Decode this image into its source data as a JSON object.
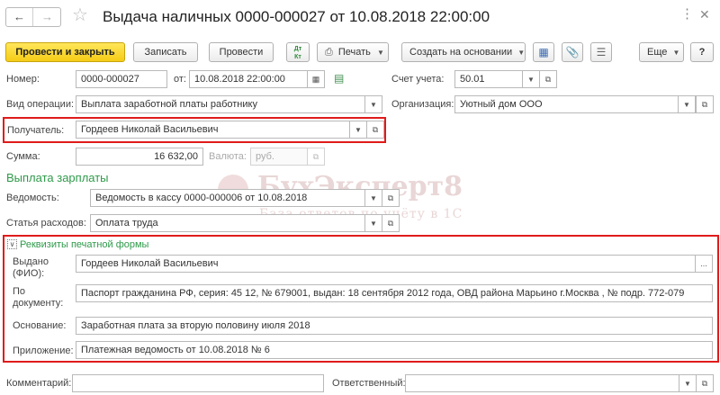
{
  "window": {
    "title": "Выдача наличных 0000-000027 от 10.08.2018 22:00:00"
  },
  "toolbar": {
    "post_close_label": "Провести и закрыть",
    "save_label": "Записать",
    "post_label": "Провести",
    "dt_kt_label": "Дт Кт",
    "print_label": "Печать",
    "create_based_label": "Создать на основании",
    "more_label": "Еще",
    "help_label": "?"
  },
  "header": {
    "number_label": "Номер:",
    "number_value": "0000-000027",
    "date_label": "от:",
    "date_value": "10.08.2018 22:00:00",
    "account_label": "Счет учета:",
    "account_value": "50.01",
    "operation_label": "Вид операции:",
    "operation_value": "Выплата заработной платы работнику",
    "organization_label": "Организация:",
    "organization_value": "Уютный дом ООО",
    "recipient_label": "Получатель:",
    "recipient_value": "Гордеев Николай Васильевич",
    "sum_label": "Сумма:",
    "sum_value": "16 632,00",
    "currency_label": "Валюта:",
    "currency_value": "руб."
  },
  "salary": {
    "title": "Выплата зарплаты",
    "statement_label": "Ведомость:",
    "statement_value": "Ведомость в кассу 0000-000006 от 10.08.2018",
    "expense_label": "Статья расходов:",
    "expense_value": "Оплата труда"
  },
  "print_form": {
    "title": "Реквизиты печатной формы",
    "issued_label_1": "Выдано",
    "issued_label_2": "(ФИО):",
    "issued_value": "Гордеев Николай Васильевич",
    "document_label_1": "По",
    "document_label_2": "документу:",
    "document_value": "Паспорт гражданина РФ, серия: 45 12, № 679001, выдан: 18 сентября 2012 года, ОВД района Марьино г.Москва , № подр. 772-079",
    "basis_label": "Основание:",
    "basis_value": "Заработная плата за вторую половину июля 2018",
    "attachment_label": "Приложение:",
    "attachment_value": "Платежная ведомость от 10.08.2018 № 6"
  },
  "footer": {
    "comment_label": "Комментарий:",
    "comment_value": "",
    "responsible_label": "Ответственный:",
    "responsible_value": ""
  },
  "watermark": {
    "line1": "БухЭксперт8",
    "line2": "База ответов по учёту в 1С"
  },
  "colors": {
    "primary_button": "#f5cc16",
    "highlight_border": "#e01b1b",
    "section_title": "#2e9a4a"
  }
}
